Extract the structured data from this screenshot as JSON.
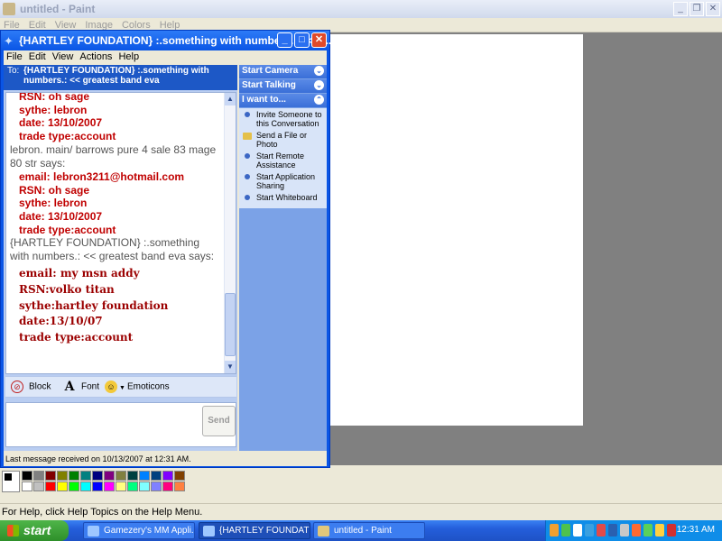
{
  "paint": {
    "title": "untitled - Paint",
    "menu": [
      "File",
      "Edit",
      "View",
      "Image",
      "Colors",
      "Help"
    ],
    "status": "For Help, click Help Topics on the Help Menu.",
    "palette_top": [
      "#000000",
      "#808080",
      "#800000",
      "#808000",
      "#008000",
      "#008080",
      "#000080",
      "#800080",
      "#808040",
      "#004040",
      "#0080ff",
      "#004080",
      "#8000ff",
      "#804000"
    ],
    "palette_bottom": [
      "#ffffff",
      "#c0c0c0",
      "#ff0000",
      "#ffff00",
      "#00ff00",
      "#00ffff",
      "#0000ff",
      "#ff00ff",
      "#ffff80",
      "#00ff80",
      "#80ffff",
      "#8080ff",
      "#ff0080",
      "#ff8040"
    ]
  },
  "msn": {
    "title": "{HARTLEY FOUNDATION} :.something with numbers.: << g...",
    "menu": [
      "File",
      "Edit",
      "View",
      "Actions",
      "Help"
    ],
    "to_label": "To:",
    "to_value": "{HARTLEY FOUNDATION} :.something with numbers.: << greatest band eva",
    "history": {
      "block1": [
        "RSN: oh sage",
        "sythe: lebron",
        "date: 13/10/2007",
        "trade type:account"
      ],
      "says1": "lebron. main/ barrows pure 4 sale 83 mage 80 str says:",
      "block2": [
        "email: lebron3211@hotmail.com",
        "RSN: oh sage",
        "sythe: lebron",
        "date: 13/10/2007",
        "trade type:account"
      ],
      "says2": "{HARTLEY FOUNDATION} :.something with numbers.: << greatest band eva says:",
      "block3": [
        "email: my msn addy",
        "RSN:volko titan",
        "sythe:hartley foundation",
        "date:13/10/07",
        "trade type:account"
      ]
    },
    "toolbar": {
      "block": "Block",
      "font": "Font",
      "emoticons": "Emoticons"
    },
    "send_label": "Send",
    "side_panel": {
      "start_camera": "Start Camera",
      "start_talking": "Start Talking",
      "i_want_to": "I want to...",
      "actions": [
        "Invite Someone to this Conversation",
        "Send a File or Photo",
        "Start Remote Assistance",
        "Start Application Sharing",
        "Start Whiteboard"
      ]
    },
    "status": "Last message received on 10/13/2007 at 12:31 AM."
  },
  "taskbar": {
    "start": "start",
    "tasks": [
      "Gamezery's MM Appli...",
      "{HARTLEY FOUNDATI...",
      "untitled - Paint"
    ],
    "clock": "12:31 AM"
  }
}
